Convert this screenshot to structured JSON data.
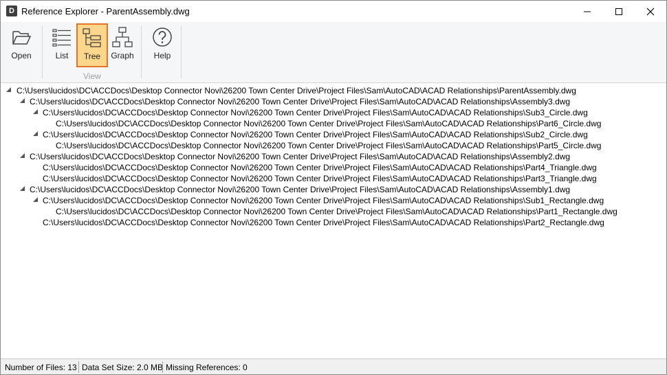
{
  "window": {
    "title": "Reference Explorer - ParentAssembly.dwg",
    "icon_letter": "D"
  },
  "ribbon": {
    "open_label": "Open",
    "list_label": "List",
    "tree_label": "Tree",
    "graph_label": "Graph",
    "help_label": "Help",
    "view_group_label": "View"
  },
  "tree": [
    "C:\\Users\\lucidos\\DC\\ACCDocs\\Desktop Connector Novi\\26200 Town Center Drive\\Project Files\\Sam\\AutoCAD\\ACAD Relationships\\ParentAssembly.dwg",
    "C:\\Users\\lucidos\\DC\\ACCDocs\\Desktop Connector Novi\\26200 Town Center Drive\\Project Files\\Sam\\AutoCAD\\ACAD Relationships\\Assembly3.dwg",
    "C:\\Users\\lucidos\\DC\\ACCDocs\\Desktop Connector Novi\\26200 Town Center Drive\\Project Files\\Sam\\AutoCAD\\ACAD Relationships\\Sub3_Circle.dwg",
    "C:\\Users\\lucidos\\DC\\ACCDocs\\Desktop Connector Novi\\26200 Town Center Drive\\Project Files\\Sam\\AutoCAD\\ACAD Relationships\\Part6_Circle.dwg",
    "C:\\Users\\lucidos\\DC\\ACCDocs\\Desktop Connector Novi\\26200 Town Center Drive\\Project Files\\Sam\\AutoCAD\\ACAD Relationships\\Sub2_Circle.dwg",
    "C:\\Users\\lucidos\\DC\\ACCDocs\\Desktop Connector Novi\\26200 Town Center Drive\\Project Files\\Sam\\AutoCAD\\ACAD Relationships\\Part5_Circle.dwg",
    "C:\\Users\\lucidos\\DC\\ACCDocs\\Desktop Connector Novi\\26200 Town Center Drive\\Project Files\\Sam\\AutoCAD\\ACAD Relationships\\Assembly2.dwg",
    "C:\\Users\\lucidos\\DC\\ACCDocs\\Desktop Connector Novi\\26200 Town Center Drive\\Project Files\\Sam\\AutoCAD\\ACAD Relationships\\Part4_Triangle.dwg",
    "C:\\Users\\lucidos\\DC\\ACCDocs\\Desktop Connector Novi\\26200 Town Center Drive\\Project Files\\Sam\\AutoCAD\\ACAD Relationships\\Part3_Triangle.dwg",
    "C:\\Users\\lucidos\\DC\\ACCDocs\\Desktop Connector Novi\\26200 Town Center Drive\\Project Files\\Sam\\AutoCAD\\ACAD Relationships\\Assembly1.dwg",
    "C:\\Users\\lucidos\\DC\\ACCDocs\\Desktop Connector Novi\\26200 Town Center Drive\\Project Files\\Sam\\AutoCAD\\ACAD Relationships\\Sub1_Rectangle.dwg",
    "C:\\Users\\lucidos\\DC\\ACCDocs\\Desktop Connector Novi\\26200 Town Center Drive\\Project Files\\Sam\\AutoCAD\\ACAD Relationships\\Part1_Rectangle.dwg",
    "C:\\Users\\lucidos\\DC\\ACCDocs\\Desktop Connector Novi\\26200 Town Center Drive\\Project Files\\Sam\\AutoCAD\\ACAD Relationships\\Part2_Rectangle.dwg"
  ],
  "status": {
    "files": "Number of Files: 13",
    "size": "Data Set Size: 2.0 MB",
    "missing": "Missing References: 0"
  },
  "colors": {
    "active_fill": "#fcd68a",
    "active_border": "#e5742b"
  }
}
